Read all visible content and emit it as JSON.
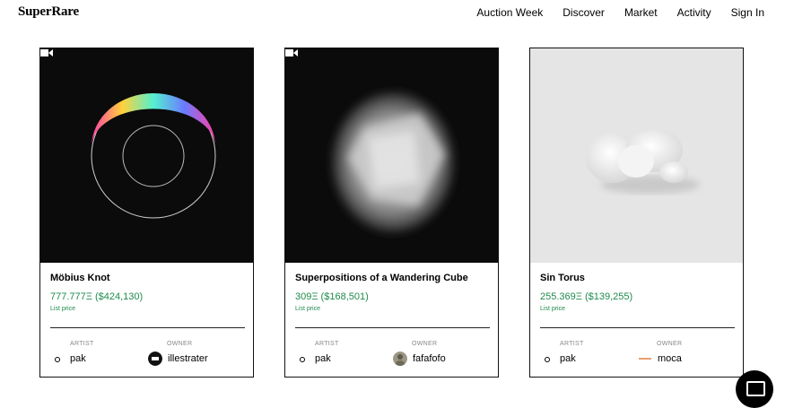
{
  "header": {
    "logo": "SuperRare",
    "nav": [
      "Auction Week",
      "Discover",
      "Market",
      "Activity",
      "Sign In"
    ]
  },
  "cards": [
    {
      "title": "Möbius Knot",
      "price": "777.777Ξ ($424,130)",
      "price_label": "List price",
      "artist_label": "ARTIST",
      "artist": "pak",
      "owner_label": "OWNER",
      "owner": "illestrater",
      "has_video": true
    },
    {
      "title": "Superpositions of a Wandering Cube",
      "price": "309Ξ ($168,501)",
      "price_label": "List price",
      "artist_label": "ARTIST",
      "artist": "pak",
      "owner_label": "OWNER",
      "owner": "fafafofo",
      "has_video": true
    },
    {
      "title": "Sin Torus",
      "price": "255.369Ξ ($139,255)",
      "price_label": "List price",
      "artist_label": "ARTIST",
      "artist": "pak",
      "owner_label": "OWNER",
      "owner": "moca",
      "has_video": false
    }
  ],
  "colors": {
    "price": "#1f8a4c",
    "art_dark": "#0b0b0b",
    "art_light": "#e5e5e5"
  },
  "icons": {
    "video": "video-camera-icon",
    "chat": "chat-icon"
  }
}
